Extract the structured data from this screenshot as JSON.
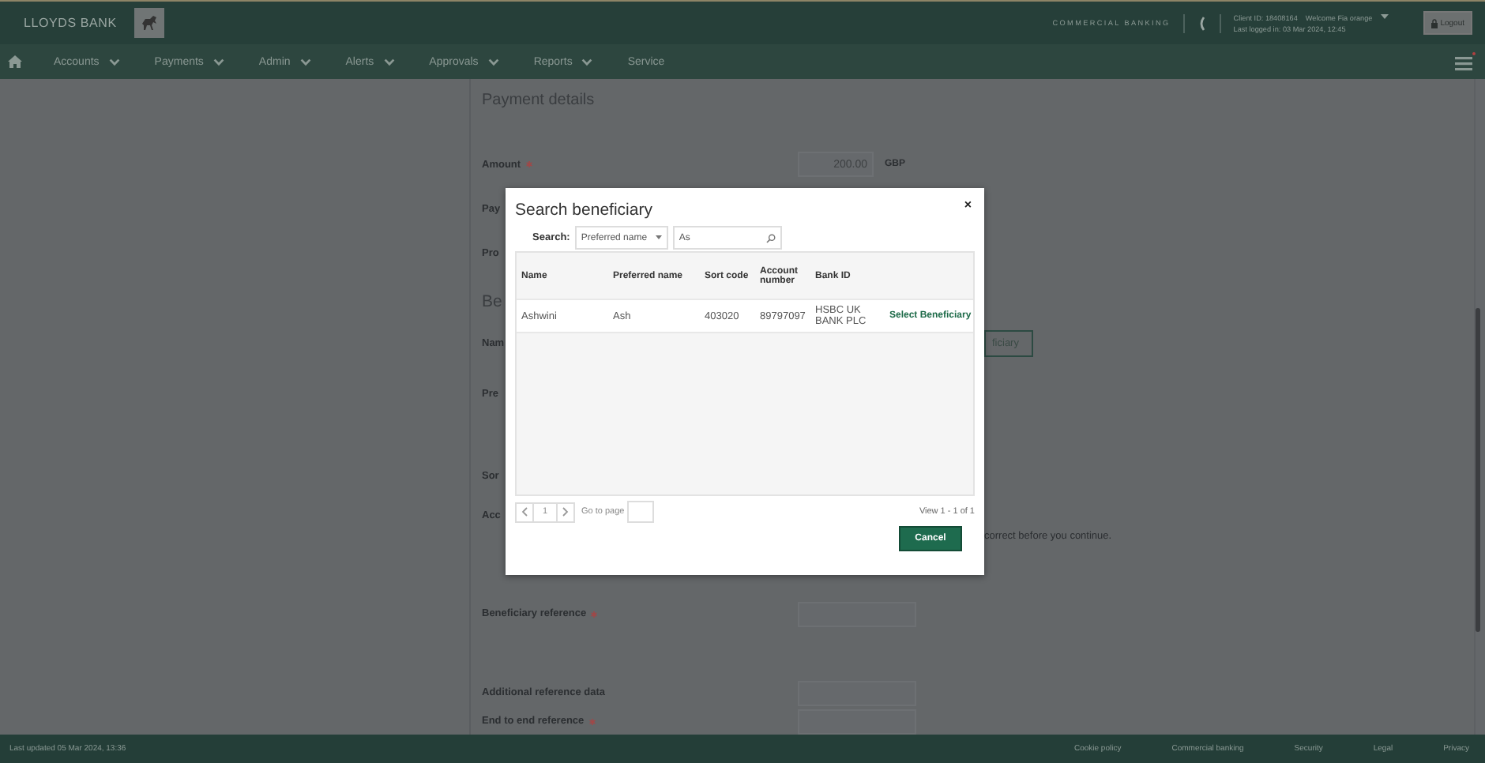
{
  "header": {
    "brand": "LLOYDS BANK",
    "segment": "COMMERCIAL BANKING",
    "client_id": "Client ID: 18408164",
    "welcome": "Welcome Fia orange",
    "last_login": "Last logged in: 03 Mar 2024, 12:45",
    "logout": "Logout"
  },
  "nav": {
    "items": [
      {
        "label": "Accounts",
        "dropdown": true
      },
      {
        "label": "Payments",
        "dropdown": true
      },
      {
        "label": "Admin",
        "dropdown": true
      },
      {
        "label": "Alerts",
        "dropdown": true
      },
      {
        "label": "Approvals",
        "dropdown": true
      },
      {
        "label": "Reports",
        "dropdown": true
      },
      {
        "label": "Service",
        "dropdown": false
      }
    ],
    "menu_alert": true
  },
  "form": {
    "title": "Payment details",
    "rows": [
      {
        "kind": "field",
        "label": "Amount",
        "required": true,
        "value": "200.00",
        "unit": "GBP"
      },
      {
        "kind": "label",
        "label": "Pay"
      },
      {
        "kind": "label",
        "label": "Pro"
      },
      {
        "kind": "heading",
        "label": "Be"
      },
      {
        "kind": "button",
        "label": "Nam",
        "button": "ficiary"
      },
      {
        "kind": "label",
        "label": "Pre"
      },
      {
        "kind": "label",
        "label": "Sor"
      },
      {
        "kind": "note",
        "label": "Acc",
        "note": "correct before you continue."
      },
      {
        "kind": "field",
        "label": "Beneficiary reference",
        "required": true
      },
      {
        "kind": "field",
        "label": "Additional reference data",
        "required": false
      },
      {
        "kind": "field",
        "label": "End to end reference",
        "required": true
      }
    ]
  },
  "modal": {
    "title": "Search beneficiary",
    "close": "×",
    "search_label": "Search:",
    "search_by": "Preferred name",
    "query": "As",
    "columns": [
      "Name",
      "Preferred name",
      "Sort code",
      "Account number",
      "Bank ID"
    ],
    "rows": [
      {
        "cells": [
          "Ashwini",
          "Ash",
          "403020",
          "89797097",
          "HSBC UK BANK PLC"
        ],
        "action": "Select Beneficiary"
      }
    ],
    "page": "1",
    "goto_label": "Go to page",
    "view": "View 1 - 1 of 1",
    "cancel": "Cancel"
  },
  "footer": {
    "updated": "Last updated 05 Mar 2024, 13:36",
    "links": [
      "Cookie policy",
      "Commercial banking",
      "Security",
      "Legal",
      "Privacy"
    ]
  }
}
